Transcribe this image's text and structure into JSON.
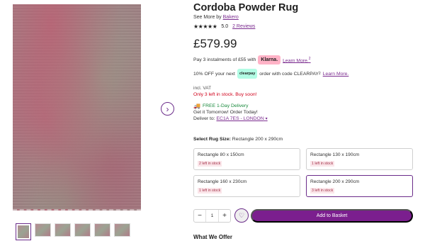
{
  "product": {
    "title": "Cordoba Powder Rug",
    "see_more_prefix": "See More by",
    "brand": "Bakero",
    "stars": "★★★★★",
    "rating": "5.0",
    "reviews": "2 Reviews",
    "price": "£579.99"
  },
  "payments": {
    "klarna_text": "Pay 3 instalments of £55 with",
    "klarna_badge": "Klarna.",
    "klarna_link": "Learn More.",
    "klarna_sup": "2",
    "clearpay_prefix": "10% OFF your next",
    "clearpay_badge": "clearpay",
    "clearpay_text": "order with code CLEARPAY",
    "clearpay_sup": "2",
    "clearpay_link": "Learn More."
  },
  "stock": {
    "vat": "incl. VAT",
    "stock_text": "Only 3 left in stock. Buy soon!",
    "delivery": "FREE 1-Day Delivery",
    "tomorrow": "Get it Tomorrow! Order Today!",
    "deliver_to_label": "Deliver to:",
    "deliver_to_value": "EC1A 7ES - LONDON"
  },
  "sizes": {
    "label": "Select Rug Size:",
    "selected": "Rectangle 200 x 290cm",
    "options": [
      {
        "name": "Rectangle 80 x 150cm",
        "stock": "2 left in stock"
      },
      {
        "name": "Rectangle 130 x 190cm",
        "stock": "1 left in stock"
      },
      {
        "name": "Rectangle 160 x 230cm",
        "stock": "1 left in stock"
      },
      {
        "name": "Rectangle 200 x 290cm",
        "stock": "3 left in stock"
      }
    ]
  },
  "cart": {
    "minus": "−",
    "quantity": "1",
    "plus": "+",
    "add_label": "Add to Basket"
  },
  "section": {
    "what_we_offer": "What We Offer"
  },
  "icons": {
    "next": "chevron-right-icon",
    "wishlist": "heart-icon",
    "delivery": "truck-icon",
    "location": "chevron-down-icon"
  },
  "colors": {
    "brand": "#7b1f8e",
    "stock_warning": "#d0021b",
    "delivery": "#1a8a3d",
    "klarna": "#ffb3c7",
    "clearpay": "#b2fce4"
  }
}
